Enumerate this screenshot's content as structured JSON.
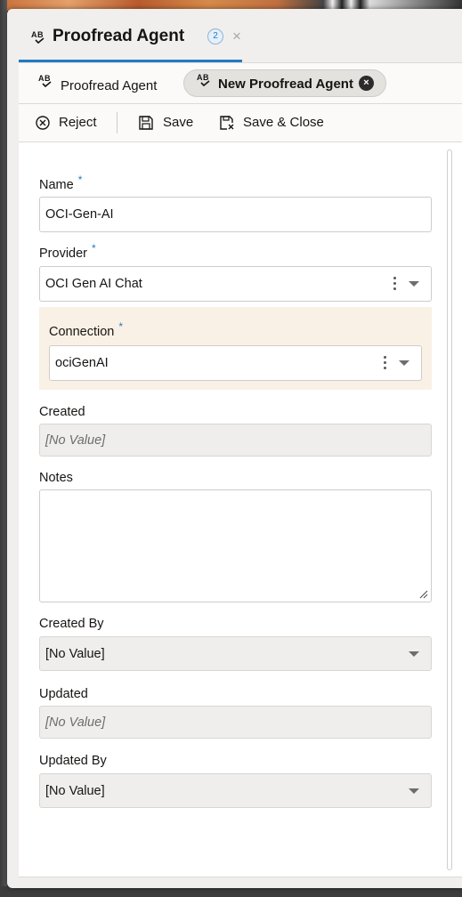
{
  "header": {
    "title": "Proofread Agent",
    "badge": "2",
    "close_glyph": "×",
    "icon": "ab-check-icon",
    "accent_color": "#227bc0"
  },
  "subtabs": [
    {
      "label": "Proofread Agent",
      "icon": "ab-check-icon",
      "active": false
    },
    {
      "label": "New Proofread Agent",
      "icon": "ab-check-icon",
      "active": true,
      "close_glyph": "×"
    }
  ],
  "toolbar": {
    "reject_label": "Reject",
    "save_label": "Save",
    "save_close_label": "Save & Close"
  },
  "form": {
    "name": {
      "label": "Name",
      "required": "*",
      "value": "OCI-Gen-AI"
    },
    "provider": {
      "label": "Provider",
      "required": "*",
      "value": "OCI Gen AI Chat"
    },
    "connection": {
      "label": "Connection",
      "required": "*",
      "value": "ociGenAI",
      "highlight_color": "#f9f1e6"
    },
    "created": {
      "label": "Created",
      "value": "[No Value]"
    },
    "notes": {
      "label": "Notes",
      "value": ""
    },
    "created_by": {
      "label": "Created By",
      "value": "[No Value]"
    },
    "updated": {
      "label": "Updated",
      "value": "[No Value]"
    },
    "updated_by": {
      "label": "Updated By",
      "value": "[No Value]"
    }
  }
}
